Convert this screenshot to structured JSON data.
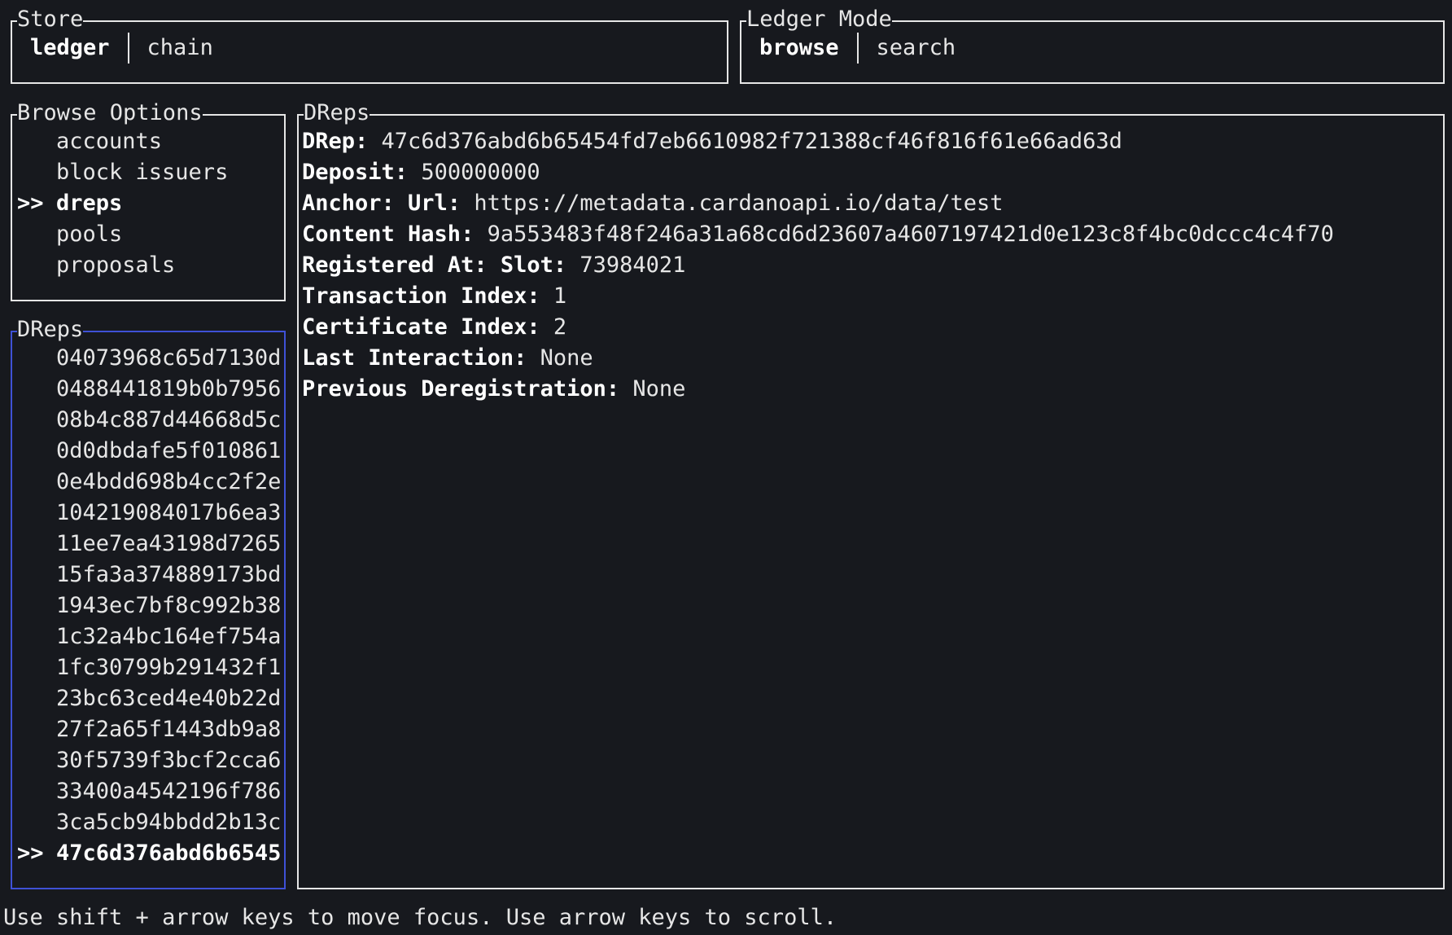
{
  "store": {
    "title": "Store",
    "tabs": [
      {
        "label": "ledger",
        "active": true
      },
      {
        "label": "chain",
        "active": false
      }
    ]
  },
  "ledger_mode": {
    "title": "Ledger Mode",
    "tabs": [
      {
        "label": "browse",
        "active": true
      },
      {
        "label": "search",
        "active": false
      }
    ]
  },
  "browse_options": {
    "title": "Browse Options",
    "marker": ">>",
    "items": [
      {
        "label": "accounts",
        "selected": false
      },
      {
        "label": "block issuers",
        "selected": false
      },
      {
        "label": "dreps",
        "selected": true
      },
      {
        "label": "pools",
        "selected": false
      },
      {
        "label": "proposals",
        "selected": false
      }
    ]
  },
  "drep_list": {
    "title": "DReps",
    "marker": ">>",
    "items": [
      {
        "label": "04073968c65d7130d",
        "selected": false
      },
      {
        "label": "0488441819b0b7956",
        "selected": false
      },
      {
        "label": "08b4c887d44668d5c",
        "selected": false
      },
      {
        "label": "0d0dbdafe5f010861",
        "selected": false
      },
      {
        "label": "0e4bdd698b4cc2f2e",
        "selected": false
      },
      {
        "label": "104219084017b6ea3",
        "selected": false
      },
      {
        "label": "11ee7ea43198d7265",
        "selected": false
      },
      {
        "label": "15fa3a374889173bd",
        "selected": false
      },
      {
        "label": "1943ec7bf8c992b38",
        "selected": false
      },
      {
        "label": "1c32a4bc164ef754a",
        "selected": false
      },
      {
        "label": "1fc30799b291432f1",
        "selected": false
      },
      {
        "label": "23bc63ced4e40b22d",
        "selected": false
      },
      {
        "label": "27f2a65f1443db9a8",
        "selected": false
      },
      {
        "label": "30f5739f3bcf2cca6",
        "selected": false
      },
      {
        "label": "33400a4542196f786",
        "selected": false
      },
      {
        "label": "3ca5cb94bbdd2b13c",
        "selected": false
      },
      {
        "label": "47c6d376abd6b6545",
        "selected": true
      }
    ]
  },
  "drep_detail": {
    "title": "DReps",
    "fields": [
      {
        "key": "DRep:",
        "value": "47c6d376abd6b65454fd7eb6610982f721388cf46f816f61e66ad63d"
      },
      {
        "key": "Deposit:",
        "value": "500000000"
      },
      {
        "key": "Anchor: Url:",
        "value": "https://metadata.cardanoapi.io/data/test"
      },
      {
        "key": "Content Hash:",
        "value": "9a553483f48f246a31a68cd6d23607a4607197421d0e123c8f4bc0dccc4c4f70"
      },
      {
        "key": "Registered At: Slot:",
        "value": "73984021"
      },
      {
        "key": "Transaction Index:",
        "value": "1"
      },
      {
        "key": "Certificate Index:",
        "value": "2"
      },
      {
        "key": "Last Interaction:",
        "value": "None"
      },
      {
        "key": "Previous Deregistration:",
        "value": "None"
      }
    ]
  },
  "footer": {
    "hint": "Use shift + arrow keys to move focus. Use arrow keys to scroll."
  },
  "colors": {
    "background": "#17191e",
    "text": "#e6e6e6",
    "focused_border": "#3f51d6"
  }
}
